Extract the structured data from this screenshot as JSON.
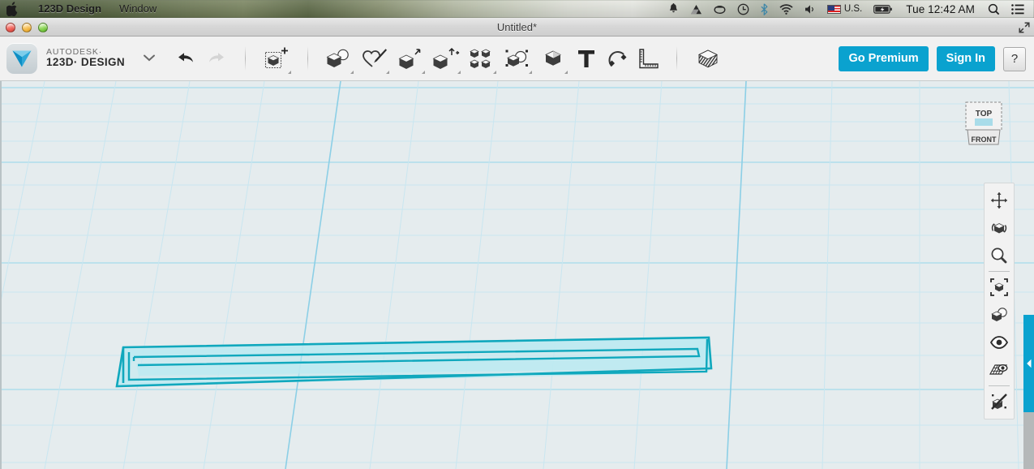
{
  "menubar": {
    "apple_icon": "apple-logo",
    "items": [
      {
        "label": "123D Design",
        "bold": true
      },
      {
        "label": "Window",
        "bold": false
      }
    ],
    "status_icons": [
      {
        "name": "notification-bell-icon",
        "glyph": "bell"
      },
      {
        "name": "google-drive-icon",
        "glyph": "drive"
      },
      {
        "name": "dropbox-icon",
        "glyph": "saucer"
      },
      {
        "name": "time-machine-icon",
        "glyph": "clock"
      },
      {
        "name": "bluetooth-icon",
        "glyph": "bluetooth"
      },
      {
        "name": "wifi-icon",
        "glyph": "wifi"
      },
      {
        "name": "volume-icon",
        "glyph": "speaker"
      }
    ],
    "input_source": "U.S.",
    "battery_icon": "battery-icon",
    "clock": "Tue 12:42 AM",
    "spotlight_icon": "search-icon",
    "notification_center_icon": "list-icon"
  },
  "window": {
    "title": "Untitled*",
    "traffic_lights": [
      "close",
      "minimize",
      "zoom"
    ],
    "fullscreen_icon": "fullscreen-icon"
  },
  "toolbar": {
    "brand": {
      "line1": "AUTODESK·",
      "line2": "123D· DESIGN",
      "logo_icon": "autodesk-123d-logo",
      "dropdown_icon": "chevron-down-icon"
    },
    "history": [
      {
        "name": "undo-button",
        "label": "Undo",
        "icon": "undo-arrow-icon",
        "disabled": false
      },
      {
        "name": "redo-button",
        "label": "Redo",
        "icon": "redo-arrow-icon",
        "disabled": true
      }
    ],
    "tools": [
      {
        "name": "transform-tool",
        "label": "Transform",
        "icon": "transform-cube-icon",
        "has_dropdown": true
      },
      {
        "name": "primitives-tool",
        "label": "Primitives",
        "icon": "primitives-cube-sphere-icon",
        "has_dropdown": true
      },
      {
        "name": "sketch-tool",
        "label": "Sketch",
        "icon": "sketch-pencil-icon",
        "has_dropdown": true
      },
      {
        "name": "construct-tool",
        "label": "Construct",
        "icon": "construct-extrude-icon",
        "has_dropdown": true
      },
      {
        "name": "modify-tool",
        "label": "Modify",
        "icon": "modify-cube-icon",
        "has_dropdown": true
      },
      {
        "name": "pattern-tool",
        "label": "Pattern",
        "icon": "pattern-four-cubes-icon",
        "has_dropdown": true
      },
      {
        "name": "grouping-tool",
        "label": "Grouping",
        "icon": "grouping-combine-icon",
        "has_dropdown": true
      },
      {
        "name": "combine-tool",
        "label": "Combine",
        "icon": "combine-cube-icon",
        "has_dropdown": true
      },
      {
        "name": "text-tool",
        "label": "Text",
        "icon": "text-t-icon",
        "has_dropdown": false
      },
      {
        "name": "snap-tool",
        "label": "Snap",
        "icon": "magnet-icon",
        "has_dropdown": false
      },
      {
        "name": "measure-tool",
        "label": "Measure",
        "icon": "ruler-icon",
        "has_dropdown": false
      },
      {
        "name": "materials-tool",
        "label": "Materials",
        "icon": "layers-stack-icon",
        "has_dropdown": false
      }
    ],
    "go_premium_label": "Go Premium",
    "sign_in_label": "Sign In",
    "help_label": "?",
    "accent_color": "#0aa2cf"
  },
  "viewcube": {
    "top_face_label": "TOP",
    "front_face_label": "FRONT",
    "highlight_color": "#a9dce9"
  },
  "rail": {
    "buttons": [
      {
        "name": "pan-button",
        "label": "Pan",
        "icon": "pan-arrows-icon"
      },
      {
        "name": "orbit-button",
        "label": "Orbit",
        "icon": "orbit-cube-icon"
      },
      {
        "name": "zoom-button",
        "label": "Zoom",
        "icon": "magnifier-icon"
      },
      {
        "name": "fit-button",
        "label": "Fit",
        "icon": "fit-brackets-cube-icon"
      },
      {
        "name": "display-button",
        "label": "Display",
        "icon": "shading-cube-sphere-icon"
      },
      {
        "name": "visibility-button",
        "label": "Visibility",
        "icon": "eye-icon"
      },
      {
        "name": "grid-button",
        "label": "Grid / Snap",
        "icon": "grid-eye-icon"
      },
      {
        "name": "hide-object-button",
        "label": "Hide",
        "icon": "crossed-cube-icon"
      }
    ]
  },
  "canvas": {
    "background_color": "#e5ecee",
    "grid_minor_color": "#c5e4ef",
    "grid_major_color": "#8ed0e6",
    "panel_toggle_icon": "chevron-left-icon",
    "panel_toggle_color": "#0aa2cf",
    "sketch": {
      "name": "spiral-sketch-profile",
      "stroke_color": "#10a8bd",
      "fill_color": "#bdeaf1",
      "description": "Long narrow rectangular spiral sketch profile"
    }
  }
}
